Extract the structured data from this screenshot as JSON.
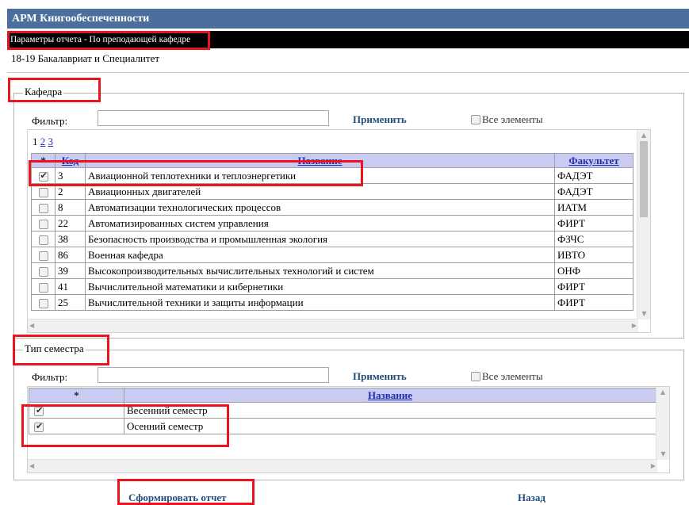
{
  "app": {
    "title": "АРМ Книгообеспеченности",
    "subtitle": "Параметры отчета - По преподающей кафедре",
    "period": "18-19 Бакалавриат и Специалитет"
  },
  "department_section": {
    "legend": "Кафедра",
    "filter_label": "Фильтр:",
    "filter_value": "",
    "apply_label": "Применить",
    "all_elements_label": "Все элементы",
    "pager": {
      "page1": "1",
      "page2": "2",
      "page3": "3"
    },
    "columns": {
      "star": "*",
      "code": "Код",
      "name": "Название",
      "faculty": "Факультет"
    },
    "rows": [
      {
        "checked": true,
        "code": "3",
        "name": "Авиационной теплотехники и теплоэнергетики",
        "faculty": "ФАДЭТ"
      },
      {
        "checked": false,
        "code": "2",
        "name": "Авиационных двигателей",
        "faculty": "ФАДЭТ"
      },
      {
        "checked": false,
        "code": "8",
        "name": "Автоматизации технологических процессов",
        "faculty": "ИАТМ"
      },
      {
        "checked": false,
        "code": "22",
        "name": "Автоматизированных систем управления",
        "faculty": "ФИРТ"
      },
      {
        "checked": false,
        "code": "38",
        "name": "Безопасность производства и промышленная экология",
        "faculty": "ФЗЧС"
      },
      {
        "checked": false,
        "code": "86",
        "name": "Военная кафедра",
        "faculty": "ИВТО"
      },
      {
        "checked": false,
        "code": "39",
        "name": "Высокопроизводительных вычислительных технологий и систем",
        "faculty": "ОНФ"
      },
      {
        "checked": false,
        "code": "41",
        "name": "Вычислительной математики и кибернетики",
        "faculty": "ФИРТ"
      },
      {
        "checked": false,
        "code": "25",
        "name": "Вычислительной техники и защиты информации",
        "faculty": "ФИРТ"
      }
    ]
  },
  "semester_section": {
    "legend": "Тип семестра",
    "filter_label": "Фильтр:",
    "filter_value": "",
    "apply_label": "Применить",
    "all_elements_label": "Все элементы",
    "columns": {
      "star": "*",
      "name": "Название"
    },
    "rows": [
      {
        "checked": true,
        "name": "Весенний семестр"
      },
      {
        "checked": true,
        "name": "Осенний семестр"
      }
    ]
  },
  "actions": {
    "generate_label": "Сформировать отчет",
    "back_label": "Назад"
  }
}
